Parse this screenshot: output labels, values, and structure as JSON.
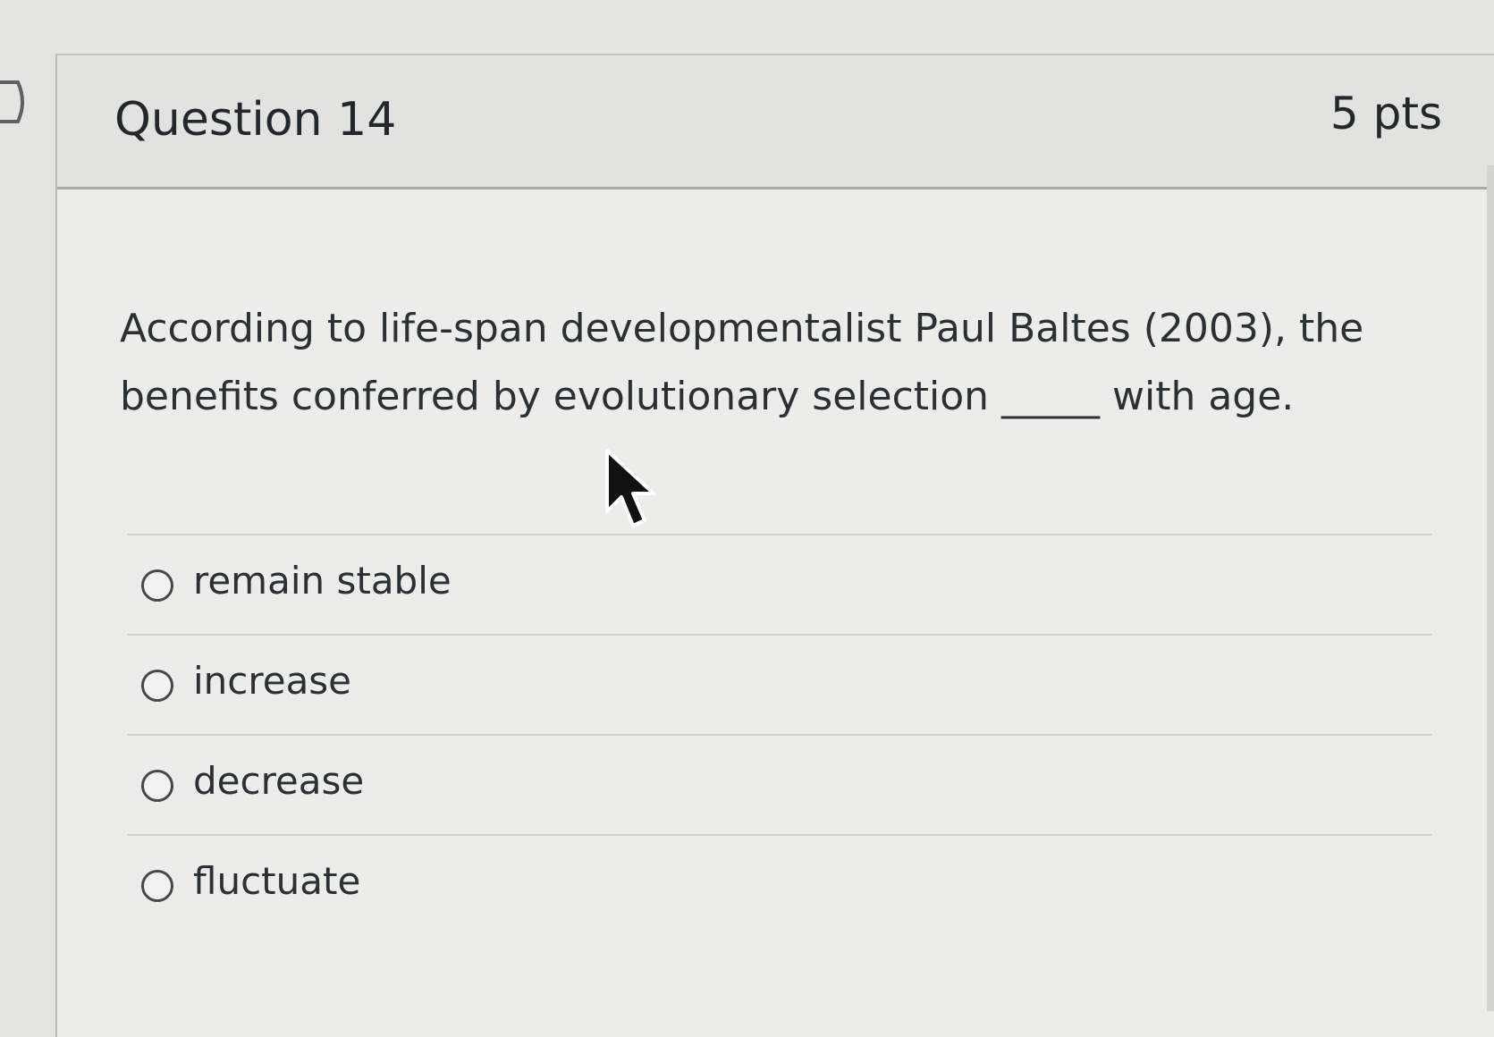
{
  "question": {
    "title": "Question 14",
    "points": "5 pts",
    "text": "According to life-span developmentalist Paul Baltes (2003), the benefits conferred by evolutionary selection _____ with age."
  },
  "answers": [
    {
      "label": "remain stable"
    },
    {
      "label": "increase"
    },
    {
      "label": "decrease"
    },
    {
      "label": "fluctuate"
    }
  ],
  "colors": {
    "text": "#2a3034",
    "header_background": "#e2e2e0",
    "card_background": "#ececea"
  },
  "icons": {
    "cursor": "mouse-pointer-icon",
    "left_marker": "chevron-right-icon",
    "radio": "radio-unselected-icon"
  }
}
